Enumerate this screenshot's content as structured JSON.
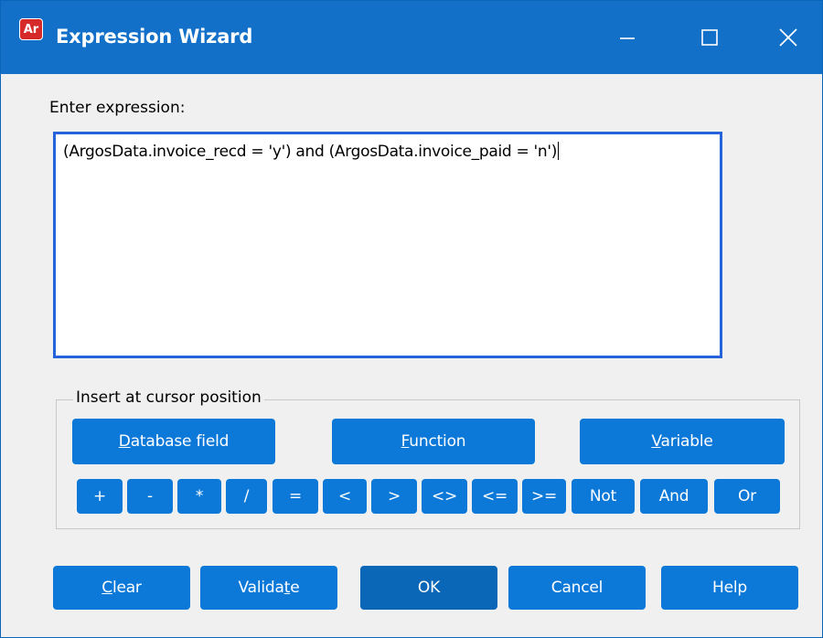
{
  "window": {
    "icon_text": "Ar",
    "title": "Expression Wizard"
  },
  "expression": {
    "label": "Enter expression:",
    "value": "(ArgosData.invoice_recd = 'y') and (ArgosData.invoice_paid = 'n')"
  },
  "insert_group": {
    "legend": "Insert at cursor position",
    "database_field": {
      "pre": "",
      "key": "D",
      "post": "atabase field"
    },
    "function": {
      "pre": "",
      "key": "F",
      "post": "unction"
    },
    "variable": {
      "pre": "",
      "key": "V",
      "post": "ariable"
    },
    "operators": [
      "+",
      "-",
      "*",
      "/",
      "=",
      "<",
      ">",
      "<>",
      "<=",
      ">=",
      "Not",
      "And",
      "Or"
    ]
  },
  "footer": {
    "clear": {
      "pre": "",
      "key": "C",
      "post": "lear"
    },
    "validate": {
      "pre": "Valida",
      "key": "t",
      "post": "e"
    },
    "ok": "OK",
    "cancel": "Cancel",
    "help": "Help"
  },
  "colors": {
    "titlebar": "#1270c8",
    "button": "#0c79d9",
    "button_primary": "#0a66b6",
    "focus_border": "#2563d8"
  },
  "icons": {
    "app": "argos-app-icon",
    "minimize": "minimize-icon",
    "maximize": "maximize-icon",
    "close": "close-icon"
  }
}
